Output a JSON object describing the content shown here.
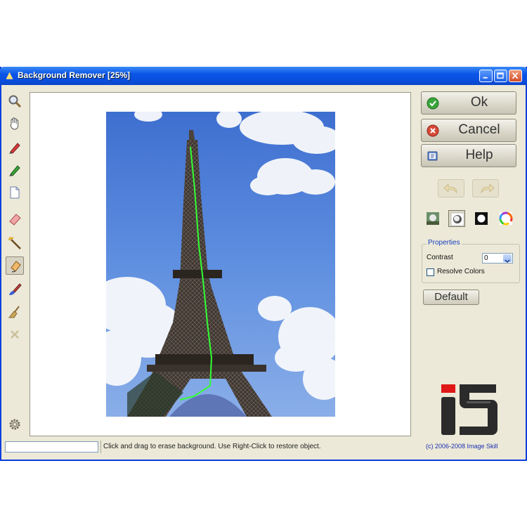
{
  "window": {
    "title": "Background Remover [25%]"
  },
  "toolbar": {
    "tools": [
      {
        "name": "zoom",
        "icon": "magnifier-icon"
      },
      {
        "name": "pan",
        "icon": "hand-icon"
      },
      {
        "name": "red-marker",
        "icon": "red-marker-icon"
      },
      {
        "name": "green-marker",
        "icon": "green-marker-icon"
      },
      {
        "name": "new",
        "icon": "blank-page-icon"
      },
      {
        "name": "eraser",
        "icon": "eraser-icon"
      },
      {
        "name": "magic-wand",
        "icon": "magic-wand-icon"
      },
      {
        "name": "background-eraser",
        "icon": "background-eraser-icon",
        "active": true
      },
      {
        "name": "restore-brush",
        "icon": "restore-brush-icon"
      },
      {
        "name": "broom",
        "icon": "broom-icon"
      },
      {
        "name": "clear",
        "icon": "x-icon"
      },
      {
        "name": "settings",
        "icon": "gear-icon"
      }
    ]
  },
  "buttons": {
    "ok": "Ok",
    "cancel": "Cancel",
    "help": "Help",
    "default": "Default"
  },
  "view_modes": [
    "original-view-icon",
    "transparency-view-icon",
    "mask-view-icon",
    "color-view-icon"
  ],
  "properties": {
    "title": "Properties",
    "contrast_label": "Contrast",
    "contrast_value": "0",
    "resolve_colors_label": "Resolve Colors",
    "resolve_colors_checked": false
  },
  "status": {
    "field_value": "",
    "message": "Click and drag to erase background. Use Right-Click to restore object.",
    "copyright": "(c) 2006-2008 Image Skill"
  },
  "colors": {
    "title_bar": "#0b55e6",
    "window_bg": "#ece9d8",
    "brush_stroke": "#33ff33",
    "logo_red": "#e01818"
  }
}
